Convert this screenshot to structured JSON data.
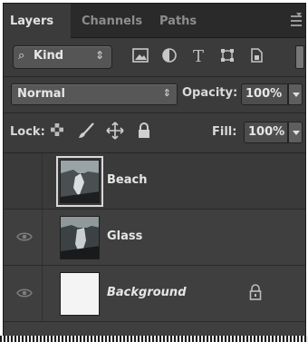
{
  "tabs": [
    {
      "label": "Layers",
      "active": true
    },
    {
      "label": "Channels",
      "active": false
    },
    {
      "label": "Paths",
      "active": false
    }
  ],
  "filter": {
    "kind_label": "Kind",
    "icons": [
      "pixel-layer-filter-icon",
      "adjustment-layer-filter-icon",
      "type-layer-filter-icon",
      "shape-layer-filter-icon",
      "smart-object-filter-icon"
    ]
  },
  "blend": {
    "mode": "Normal",
    "opacity_label": "Opacity:",
    "opacity_value": "100%"
  },
  "lock": {
    "label": "Lock:",
    "fill_label": "Fill:",
    "fill_value": "100%"
  },
  "layers": [
    {
      "name": "Beach",
      "visible": false,
      "selected": true
    },
    {
      "name": "Glass",
      "visible": true,
      "selected": false
    },
    {
      "name": "Background",
      "visible": true,
      "selected": false,
      "locked": true
    }
  ],
  "colors": {
    "panel_bg": "#3b3b3b",
    "tab_bar": "#2a2a2a",
    "text": "#e6e6e6"
  }
}
